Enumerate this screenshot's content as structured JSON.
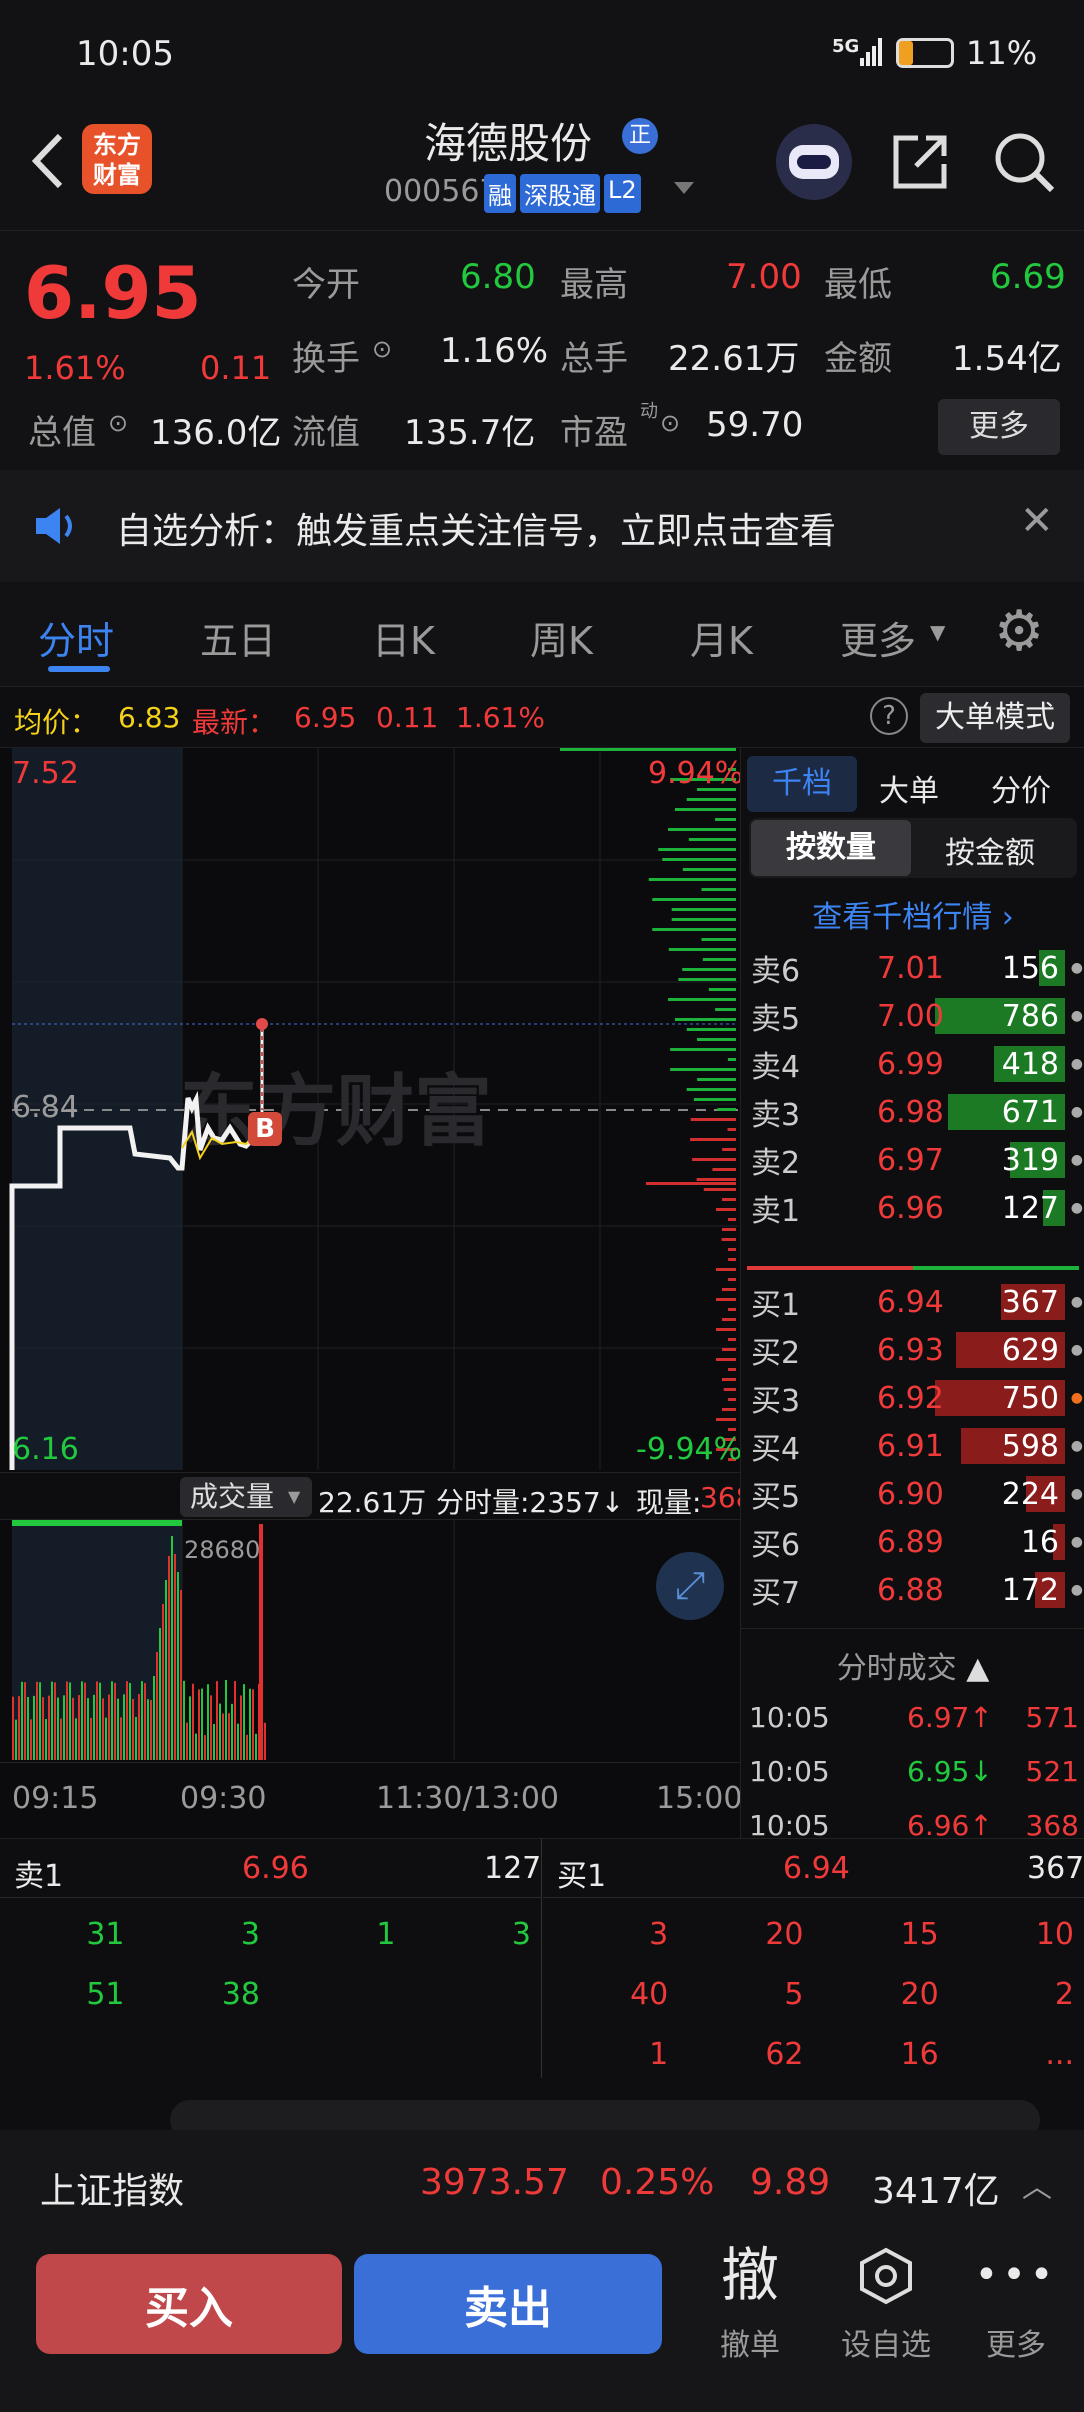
{
  "status": {
    "time": "10:05",
    "network": "5G",
    "battery": "11%"
  },
  "header": {
    "title": "海德股份",
    "title_badge": "正",
    "code": "000567",
    "tags": [
      "融",
      "深股通",
      "L2"
    ],
    "logo_text": "东方财富"
  },
  "quote": {
    "price": "6.95",
    "change_pct": "1.61%",
    "change": "0.11",
    "open_label": "今开",
    "open": "6.80",
    "high_label": "最高",
    "high": "7.00",
    "low_label": "最低",
    "low": "6.69",
    "turnover_label": "换手",
    "turnover": "1.16%",
    "volume_label": "总手",
    "volume": "22.61万",
    "amount_label": "金额",
    "amount": "1.54亿",
    "mcap_label": "总值",
    "mcap": "136.0亿",
    "float_label": "流值",
    "float": "135.7亿",
    "pe_label": "市盈",
    "pe_sup": "动",
    "pe": "59.70",
    "more_label": "更多"
  },
  "notice": {
    "text": "自选分析：触发重点关注信号，立即点击查看"
  },
  "tabs": [
    "分时",
    "五日",
    "日K",
    "周K",
    "月K",
    "更多"
  ],
  "subbar": {
    "avg_label": "均价：",
    "avg": "6.83",
    "latest_label": "最新：",
    "latest": "6.95",
    "chg": "0.11",
    "pct": "1.61%",
    "mode_label": "大单模式"
  },
  "chart": {
    "top_price": "7.52",
    "top_pct": "9.94%",
    "mid_price": "6.84",
    "bot_price": "6.16",
    "bot_pct": "-9.94%",
    "watermark": "东方财富",
    "marker": "B",
    "vol_selector": "成交量",
    "vol_total": "22.61万",
    "minute_vol": "分时量:2357↓",
    "cur_vol_label": "现量:",
    "cur_vol": "368",
    "vol_max": "28680",
    "time_labels": [
      "09:15",
      "09:30",
      "11:30/13:00",
      "15:00"
    ]
  },
  "chart_data": {
    "type": "line",
    "title": "",
    "x": [
      "09:15",
      "09:30",
      "11:30/13:00",
      "15:00"
    ],
    "ylim": [
      6.16,
      7.52
    ],
    "reference": 6.84,
    "series": [
      {
        "name": "",
        "values": [
          6.84,
          6.95
        ]
      }
    ]
  },
  "book": {
    "tabs": [
      "千档",
      "大单",
      "分价"
    ],
    "toggle": [
      "按数量",
      "按金额"
    ],
    "link": "查看千档行情 ›",
    "sells": [
      {
        "label": "卖6",
        "price": "7.01",
        "vol": "156",
        "bar": 0.2
      },
      {
        "label": "卖5",
        "price": "7.00",
        "vol": "786",
        "bar": 1.0
      },
      {
        "label": "卖4",
        "price": "6.99",
        "vol": "418",
        "bar": 0.55
      },
      {
        "label": "卖3",
        "price": "6.98",
        "vol": "671",
        "bar": 0.9
      },
      {
        "label": "卖2",
        "price": "6.97",
        "vol": "319",
        "bar": 0.42
      },
      {
        "label": "卖1",
        "price": "6.96",
        "vol": "127",
        "bar": 0.17
      }
    ],
    "buys": [
      {
        "label": "买1",
        "price": "6.94",
        "vol": "367",
        "bar": 0.49
      },
      {
        "label": "买2",
        "price": "6.93",
        "vol": "629",
        "bar": 0.84
      },
      {
        "label": "买3",
        "price": "6.92",
        "vol": "750",
        "bar": 1.0
      },
      {
        "label": "买4",
        "price": "6.91",
        "vol": "598",
        "bar": 0.8
      },
      {
        "label": "买5",
        "price": "6.90",
        "vol": "224",
        "bar": 0.3
      },
      {
        "label": "买6",
        "price": "6.89",
        "vol": "16",
        "bar": 0.03
      },
      {
        "label": "买7",
        "price": "6.88",
        "vol": "172",
        "bar": 0.23
      }
    ],
    "trades_title": "分时成交",
    "trades": [
      {
        "time": "10:05",
        "price": "6.97↑",
        "vol": "571",
        "color": "red"
      },
      {
        "time": "10:05",
        "price": "6.95↓",
        "vol": "521",
        "color": "green"
      },
      {
        "time": "10:05",
        "price": "6.96↑",
        "vol": "368",
        "color": "red"
      }
    ]
  },
  "bottom": {
    "sell_label": "卖1",
    "sell_price": "6.96",
    "sell_vol": "127",
    "buy_label": "买1",
    "buy_price": "6.94",
    "buy_vol": "367",
    "sell_rows": [
      [
        "31",
        "3",
        "1",
        "3"
      ],
      [
        "51",
        "38",
        "",
        ""
      ]
    ],
    "buy_rows": [
      [
        "3",
        "20",
        "15",
        "10"
      ],
      [
        "40",
        "5",
        "20",
        "2"
      ],
      [
        "1",
        "62",
        "16",
        "..."
      ]
    ]
  },
  "index": {
    "name": "上证指数",
    "value": "3973.57",
    "pct": "0.25%",
    "chg": "9.89",
    "amount": "3417亿"
  },
  "actions": {
    "buy": "买入",
    "sell": "卖出",
    "cancel_icon": "撤",
    "cancel": "撤单",
    "set_fav": "设自选",
    "more": "更多"
  }
}
